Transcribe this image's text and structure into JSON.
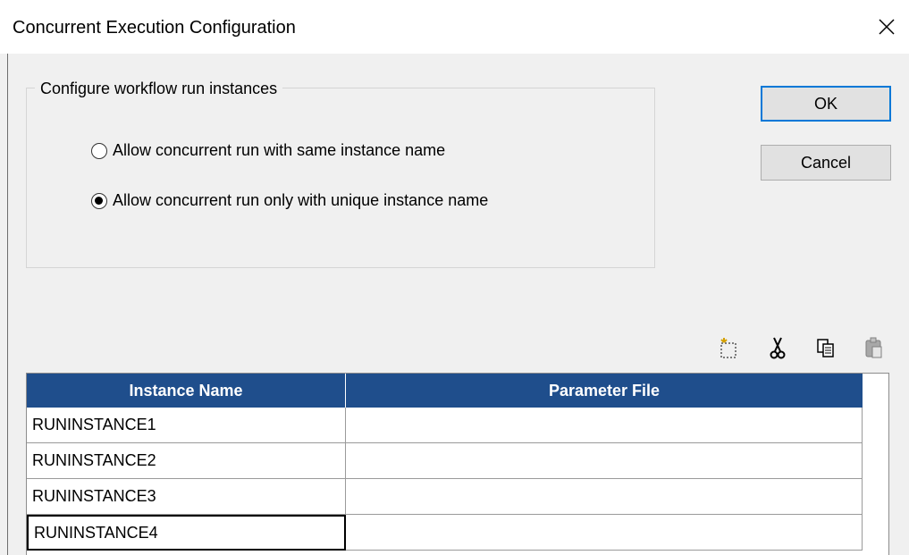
{
  "window": {
    "title": "Concurrent Execution Configuration"
  },
  "group": {
    "legend": "Configure workflow run instances",
    "options": [
      {
        "label": "Allow concurrent run with same instance name",
        "checked": false
      },
      {
        "label": "Allow concurrent run only with unique instance name",
        "checked": true
      }
    ]
  },
  "buttons": {
    "ok": "OK",
    "cancel": "Cancel"
  },
  "toolbar": {
    "icons": [
      "new-row-icon",
      "cut-icon",
      "copy-icon",
      "paste-icon"
    ]
  },
  "table": {
    "columns": [
      "Instance Name",
      "Parameter File"
    ],
    "rows": [
      {
        "instance": "RUNINSTANCE1",
        "param": ""
      },
      {
        "instance": "RUNINSTANCE2",
        "param": ""
      },
      {
        "instance": "RUNINSTANCE3",
        "param": ""
      },
      {
        "instance": "RUNINSTANCE4",
        "param": ""
      }
    ],
    "selected_row": 3
  },
  "colors": {
    "header_bg": "#1f4e8c",
    "focus_border": "#0078d7"
  }
}
